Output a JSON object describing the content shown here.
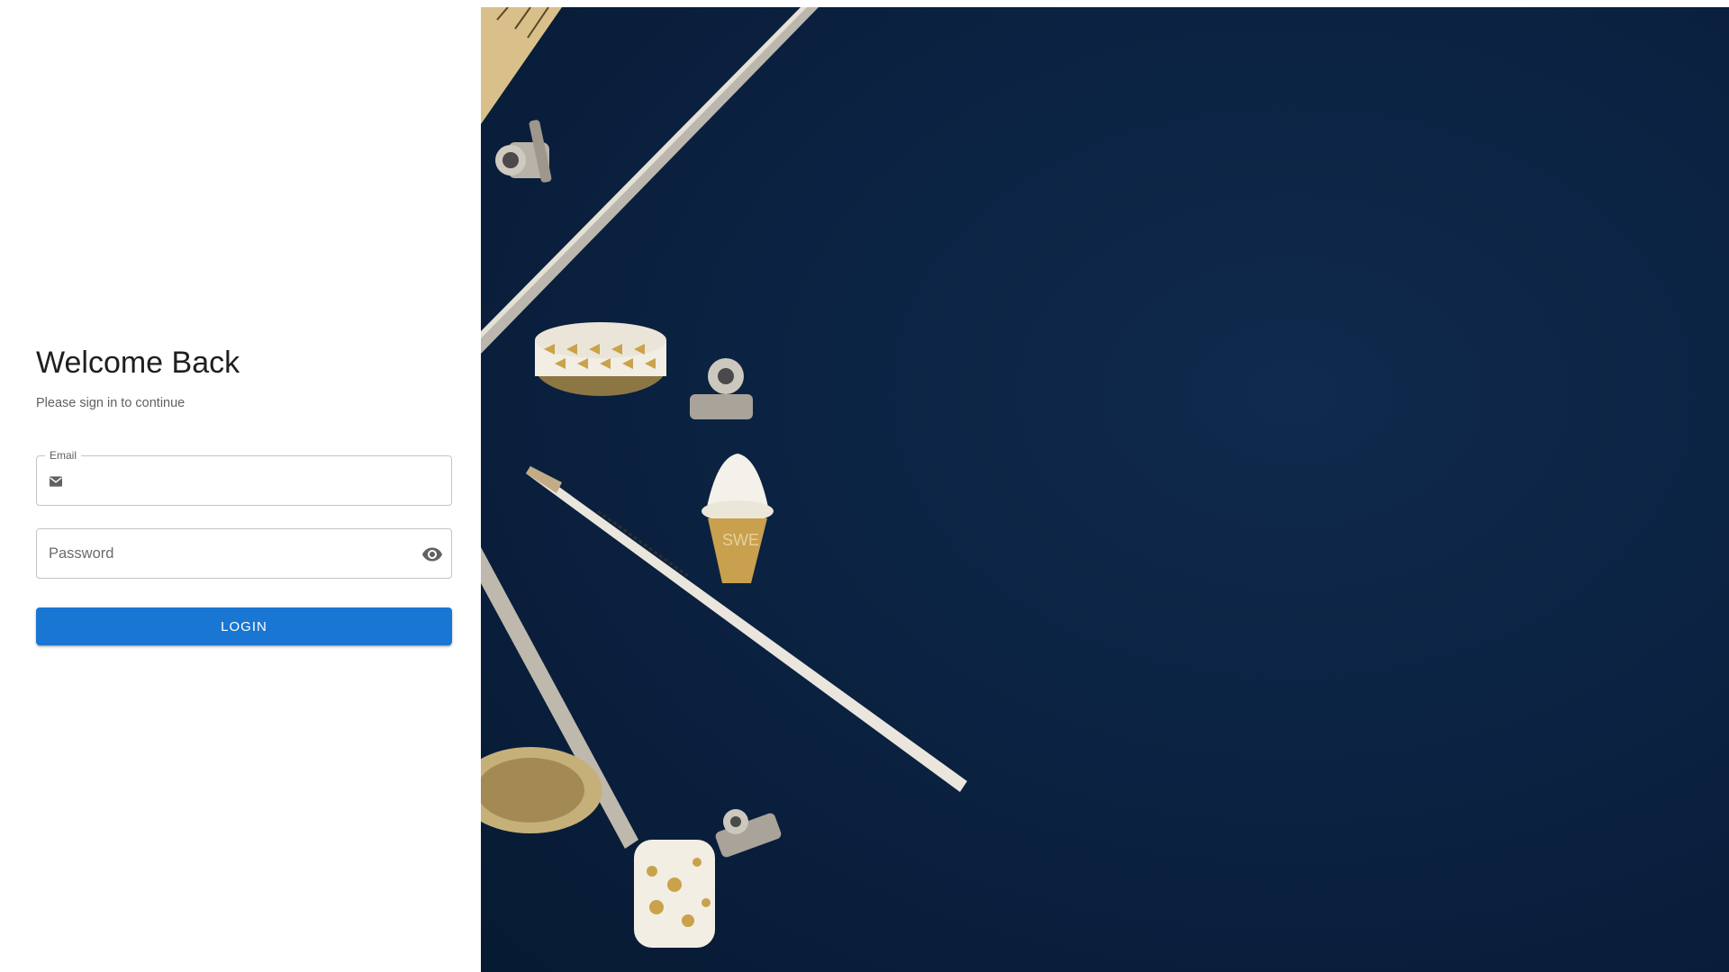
{
  "login": {
    "title": "Welcome Back",
    "subtitle": "Please sign in to continue",
    "email": {
      "label": "Email",
      "value": "",
      "icon": "mail-icon"
    },
    "password": {
      "placeholder": "Password",
      "value": "",
      "toggle_icon": "eye-icon"
    },
    "submit_label": "LOGIN"
  },
  "hero_image": {
    "description_icon": "stationery-photo",
    "cone_text": "SWE"
  },
  "colors": {
    "primary": "#1976d2",
    "background_image": "#0b2140",
    "border": "#c4c4c4"
  }
}
